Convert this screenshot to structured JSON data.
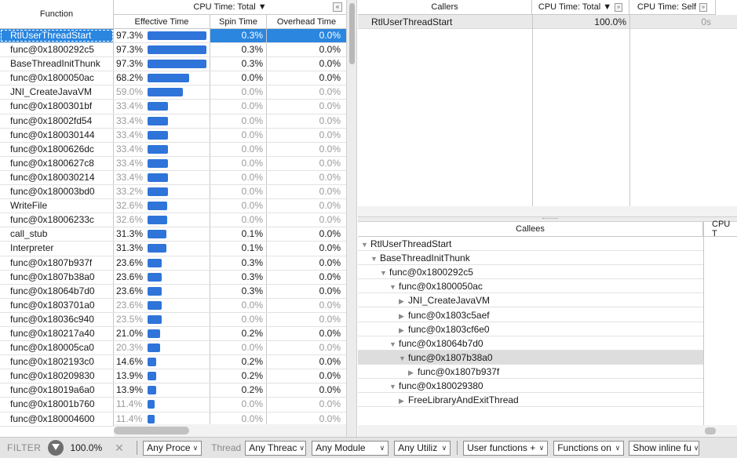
{
  "left_grid": {
    "col_function": "Function",
    "col_group": "CPU Time: Total ▼",
    "col_group_btn": "«",
    "col_effective": "Effective Time",
    "col_spin": "Spin Time",
    "col_overhead": "Overhead Time",
    "rows": [
      {
        "fn": "RtlUserThreadStart",
        "eff": "97.3%",
        "effv": 97.3,
        "spin": "0.3%",
        "ovh": "0.0%",
        "dim": false,
        "sel": true
      },
      {
        "fn": "func@0x1800292c5",
        "eff": "97.3%",
        "effv": 97.3,
        "spin": "0.3%",
        "ovh": "0.0%",
        "dim": false,
        "sel": false
      },
      {
        "fn": "BaseThreadInitThunk",
        "eff": "97.3%",
        "effv": 97.3,
        "spin": "0.3%",
        "ovh": "0.0%",
        "dim": false,
        "sel": false
      },
      {
        "fn": "func@0x1800050ac",
        "eff": "68.2%",
        "effv": 68.2,
        "spin": "0.0%",
        "ovh": "0.0%",
        "dim": false,
        "sel": false
      },
      {
        "fn": "JNI_CreateJavaVM",
        "eff": "59.0%",
        "effv": 59.0,
        "spin": "0.0%",
        "ovh": "0.0%",
        "dim": true,
        "sel": false
      },
      {
        "fn": "func@0x1800301bf",
        "eff": "33.4%",
        "effv": 33.4,
        "spin": "0.0%",
        "ovh": "0.0%",
        "dim": true,
        "sel": false
      },
      {
        "fn": "func@0x18002fd54",
        "eff": "33.4%",
        "effv": 33.4,
        "spin": "0.0%",
        "ovh": "0.0%",
        "dim": true,
        "sel": false
      },
      {
        "fn": "func@0x180030144",
        "eff": "33.4%",
        "effv": 33.4,
        "spin": "0.0%",
        "ovh": "0.0%",
        "dim": true,
        "sel": false
      },
      {
        "fn": "func@0x1800626dc",
        "eff": "33.4%",
        "effv": 33.4,
        "spin": "0.0%",
        "ovh": "0.0%",
        "dim": true,
        "sel": false
      },
      {
        "fn": "func@0x1800627c8",
        "eff": "33.4%",
        "effv": 33.4,
        "spin": "0.0%",
        "ovh": "0.0%",
        "dim": true,
        "sel": false
      },
      {
        "fn": "func@0x180030214",
        "eff": "33.4%",
        "effv": 33.4,
        "spin": "0.0%",
        "ovh": "0.0%",
        "dim": true,
        "sel": false
      },
      {
        "fn": "func@0x180003bd0",
        "eff": "33.2%",
        "effv": 33.2,
        "spin": "0.0%",
        "ovh": "0.0%",
        "dim": true,
        "sel": false
      },
      {
        "fn": "WriteFile",
        "eff": "32.6%",
        "effv": 32.6,
        "spin": "0.0%",
        "ovh": "0.0%",
        "dim": true,
        "sel": false
      },
      {
        "fn": "func@0x18006233c",
        "eff": "32.6%",
        "effv": 32.6,
        "spin": "0.0%",
        "ovh": "0.0%",
        "dim": true,
        "sel": false
      },
      {
        "fn": "call_stub",
        "eff": "31.3%",
        "effv": 31.3,
        "spin": "0.1%",
        "ovh": "0.0%",
        "dim": false,
        "sel": false
      },
      {
        "fn": "Interpreter",
        "eff": "31.3%",
        "effv": 31.3,
        "spin": "0.1%",
        "ovh": "0.0%",
        "dim": false,
        "sel": false
      },
      {
        "fn": "func@0x1807b937f",
        "eff": "23.6%",
        "effv": 23.6,
        "spin": "0.3%",
        "ovh": "0.0%",
        "dim": false,
        "sel": false
      },
      {
        "fn": "func@0x1807b38a0",
        "eff": "23.6%",
        "effv": 23.6,
        "spin": "0.3%",
        "ovh": "0.0%",
        "dim": false,
        "sel": false
      },
      {
        "fn": "func@0x18064b7d0",
        "eff": "23.6%",
        "effv": 23.6,
        "spin": "0.3%",
        "ovh": "0.0%",
        "dim": false,
        "sel": false
      },
      {
        "fn": "func@0x1803701a0",
        "eff": "23.6%",
        "effv": 23.6,
        "spin": "0.0%",
        "ovh": "0.0%",
        "dim": true,
        "sel": false
      },
      {
        "fn": "func@0x18036c940",
        "eff": "23.5%",
        "effv": 23.5,
        "spin": "0.0%",
        "ovh": "0.0%",
        "dim": true,
        "sel": false
      },
      {
        "fn": "func@0x180217a40",
        "eff": "21.0%",
        "effv": 21.0,
        "spin": "0.2%",
        "ovh": "0.0%",
        "dim": false,
        "sel": false
      },
      {
        "fn": "func@0x180005ca0",
        "eff": "20.3%",
        "effv": 20.3,
        "spin": "0.0%",
        "ovh": "0.0%",
        "dim": true,
        "sel": false
      },
      {
        "fn": "func@0x1802193c0",
        "eff": "14.6%",
        "effv": 14.6,
        "spin": "0.2%",
        "ovh": "0.0%",
        "dim": false,
        "sel": false
      },
      {
        "fn": "func@0x180209830",
        "eff": "13.9%",
        "effv": 13.9,
        "spin": "0.2%",
        "ovh": "0.0%",
        "dim": false,
        "sel": false
      },
      {
        "fn": "func@0x18019a6a0",
        "eff": "13.9%",
        "effv": 13.9,
        "spin": "0.2%",
        "ovh": "0.0%",
        "dim": false,
        "sel": false
      },
      {
        "fn": "func@0x18001b760",
        "eff": "11.4%",
        "effv": 11.4,
        "spin": "0.0%",
        "ovh": "0.0%",
        "dim": true,
        "sel": false
      },
      {
        "fn": "func@0x180004600",
        "eff": "11.4%",
        "effv": 11.4,
        "spin": "0.0%",
        "ovh": "0.0%",
        "dim": true,
        "sel": false
      }
    ]
  },
  "callers": {
    "col_callers": "Callers",
    "col_total": "CPU Time: Total ▼",
    "col_self": "CPU Time: Self",
    "btn_expand": "»",
    "row": {
      "name": "RtlUserThreadStart",
      "total": "100.0%",
      "self": "0s"
    }
  },
  "callees": {
    "col_callees": "Callees",
    "col_cpu": "CPU T",
    "tree": [
      {
        "label": "RtlUserThreadStart",
        "depth": 0,
        "icon": "▼",
        "sel": false
      },
      {
        "label": "BaseThreadInitThunk",
        "depth": 1,
        "icon": "▼",
        "sel": false
      },
      {
        "label": "func@0x1800292c5",
        "depth": 2,
        "icon": "▼",
        "sel": false
      },
      {
        "label": "func@0x1800050ac",
        "depth": 3,
        "icon": "▼",
        "sel": false
      },
      {
        "label": "JNI_CreateJavaVM",
        "depth": 4,
        "icon": "▶",
        "sel": false
      },
      {
        "label": "func@0x1803c5aef",
        "depth": 4,
        "icon": "▶",
        "sel": false
      },
      {
        "label": "func@0x1803cf6e0",
        "depth": 4,
        "icon": "▶",
        "sel": false
      },
      {
        "label": "func@0x18064b7d0",
        "depth": 3,
        "icon": "▼",
        "sel": false
      },
      {
        "label": "func@0x1807b38a0",
        "depth": 4,
        "icon": "▼",
        "sel": true
      },
      {
        "label": "func@0x1807b937f",
        "depth": 5,
        "icon": "▶",
        "sel": false
      },
      {
        "label": "func@0x180029380",
        "depth": 3,
        "icon": "▼",
        "sel": false
      },
      {
        "label": "FreeLibraryAndExitThread",
        "depth": 4,
        "icon": "▶",
        "sel": false
      }
    ]
  },
  "filter": {
    "label": "FILTER",
    "percent": "100.0%",
    "process": "Any Proce",
    "thread_label": "Thread",
    "thread": "Any Threac",
    "module": "Any Module",
    "utilization": "Any Utiliz",
    "user_functions": "User functions +",
    "functions_on": "Functions on",
    "inline": "Show inline fu"
  },
  "colors": {
    "bar": "#2f74d9",
    "selection": "#2a86df",
    "tree_selection": "#dddddd"
  }
}
